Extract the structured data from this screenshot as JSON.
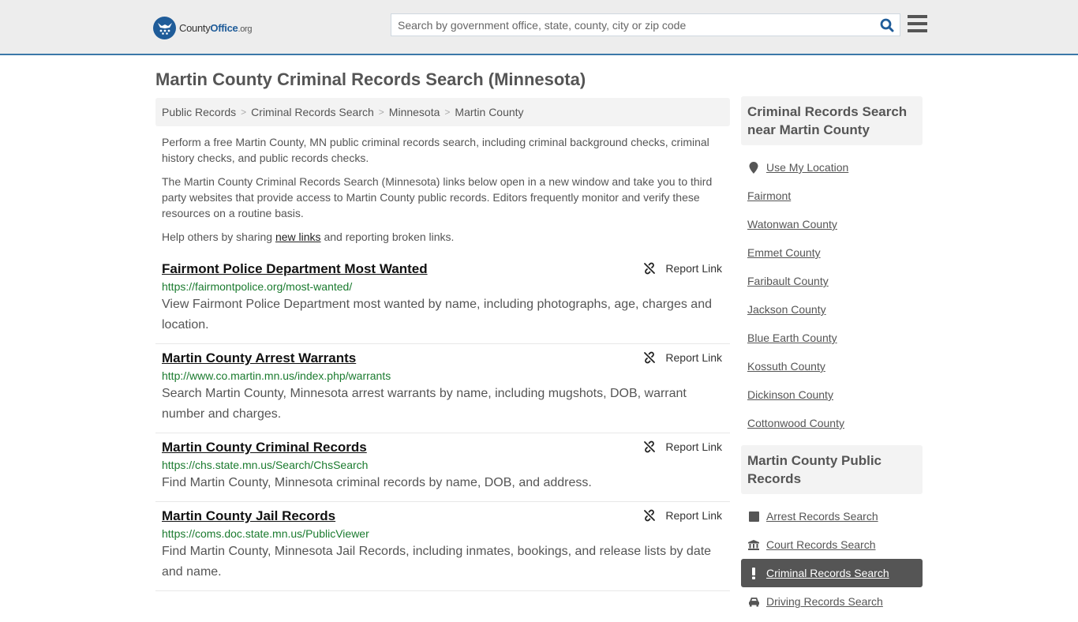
{
  "header": {
    "logo": {
      "brand_prefix": "County",
      "brand_highlight": "Office",
      "brand_suffix": ".org"
    },
    "search": {
      "placeholder": "Search by government office, state, county, city or zip code",
      "value": ""
    },
    "icons": {
      "search": "search-icon",
      "menu": "hamburger-menu-icon"
    }
  },
  "page": {
    "title": "Martin County Criminal Records Search (Minnesota)"
  },
  "breadcrumb": [
    {
      "label": "Public Records"
    },
    {
      "label": "Criminal Records Search"
    },
    {
      "label": "Minnesota"
    },
    {
      "label": "Martin County"
    }
  ],
  "breadcrumb_separator": ">",
  "intro": {
    "p1": "Perform a free Martin County, MN public criminal records search, including criminal background checks, criminal history checks, and public records checks.",
    "p2": "The Martin County Criminal Records Search (Minnesota) links below open in a new window and take you to third party websites that provide access to Martin County public records. Editors frequently monitor and verify these resources on a routine basis.",
    "p3_before": "Help others by sharing ",
    "p3_link": "new links",
    "p3_after": " and reporting broken links."
  },
  "report_label": "Report Link",
  "results": [
    {
      "title": "Fairmont Police Department Most Wanted",
      "url": "https://fairmontpolice.org/most-wanted/",
      "description": "View Fairmont Police Department most wanted by name, including photographs, age, charges and location."
    },
    {
      "title": "Martin County Arrest Warrants",
      "url": "http://www.co.martin.mn.us/index.php/warrants",
      "description": "Search Martin County, Minnesota arrest warrants by name, including mugshots, DOB, warrant number and charges."
    },
    {
      "title": "Martin County Criminal Records",
      "url": "https://chs.state.mn.us/Search/ChsSearch",
      "description": "Find Martin County, Minnesota criminal records by name, DOB, and address."
    },
    {
      "title": "Martin County Jail Records",
      "url": "https://coms.doc.state.mn.us/PublicViewer",
      "description": "Find Martin County, Minnesota Jail Records, including inmates, bookings, and release lists by date and name."
    }
  ],
  "sidebar": {
    "nearby_heading": "Criminal Records Search near Martin County",
    "use_location": "Use My Location",
    "nearby": [
      "Fairmont",
      "Watonwan County",
      "Emmet County",
      "Faribault County",
      "Jackson County",
      "Blue Earth County",
      "Kossuth County",
      "Dickinson County",
      "Cottonwood County"
    ],
    "public_records_heading": "Martin County Public Records",
    "public_records": [
      {
        "label": "Arrest Records Search",
        "icon": "square-icon",
        "active": false
      },
      {
        "label": "Court Records Search",
        "icon": "courthouse-icon",
        "active": false
      },
      {
        "label": "Criminal Records Search",
        "icon": "exclamation-icon",
        "active": true
      },
      {
        "label": "Driving Records Search",
        "icon": "car-icon",
        "active": false
      }
    ]
  },
  "colors": {
    "brand_blue": "#1f5c99",
    "header_border": "#3b78a8",
    "url_green": "#1b7b2f",
    "active_item_bg": "#555555"
  }
}
